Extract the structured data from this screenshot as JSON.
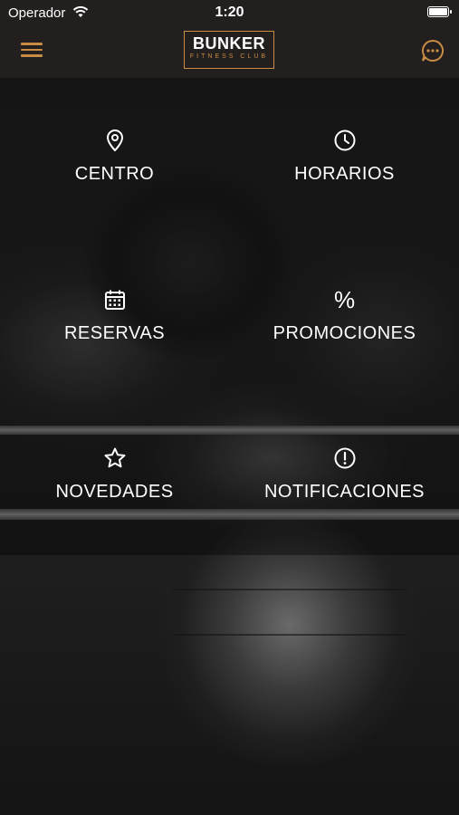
{
  "status_bar": {
    "carrier": "Operador",
    "time": "1:20"
  },
  "header": {
    "logo_main": "BUNKER",
    "logo_sub": "FITNESS CLUB",
    "menu_icon": "hamburger-menu-icon",
    "chat_icon": "chat-bubble-icon"
  },
  "colors": {
    "accent": "#c98c45",
    "bar": "#221f1e"
  },
  "menu": {
    "items": [
      {
        "label": "CENTRO",
        "icon": "location-pin-icon"
      },
      {
        "label": "HORARIOS",
        "icon": "clock-icon"
      },
      {
        "label": "RESERVAS",
        "icon": "calendar-icon"
      },
      {
        "label": "PROMOCIONES",
        "icon": "percent-icon",
        "glyph": "%"
      },
      {
        "label": "NOVEDADES",
        "icon": "star-icon"
      },
      {
        "label": "NOTIFICACIONES",
        "icon": "exclamation-circle-icon"
      }
    ]
  }
}
